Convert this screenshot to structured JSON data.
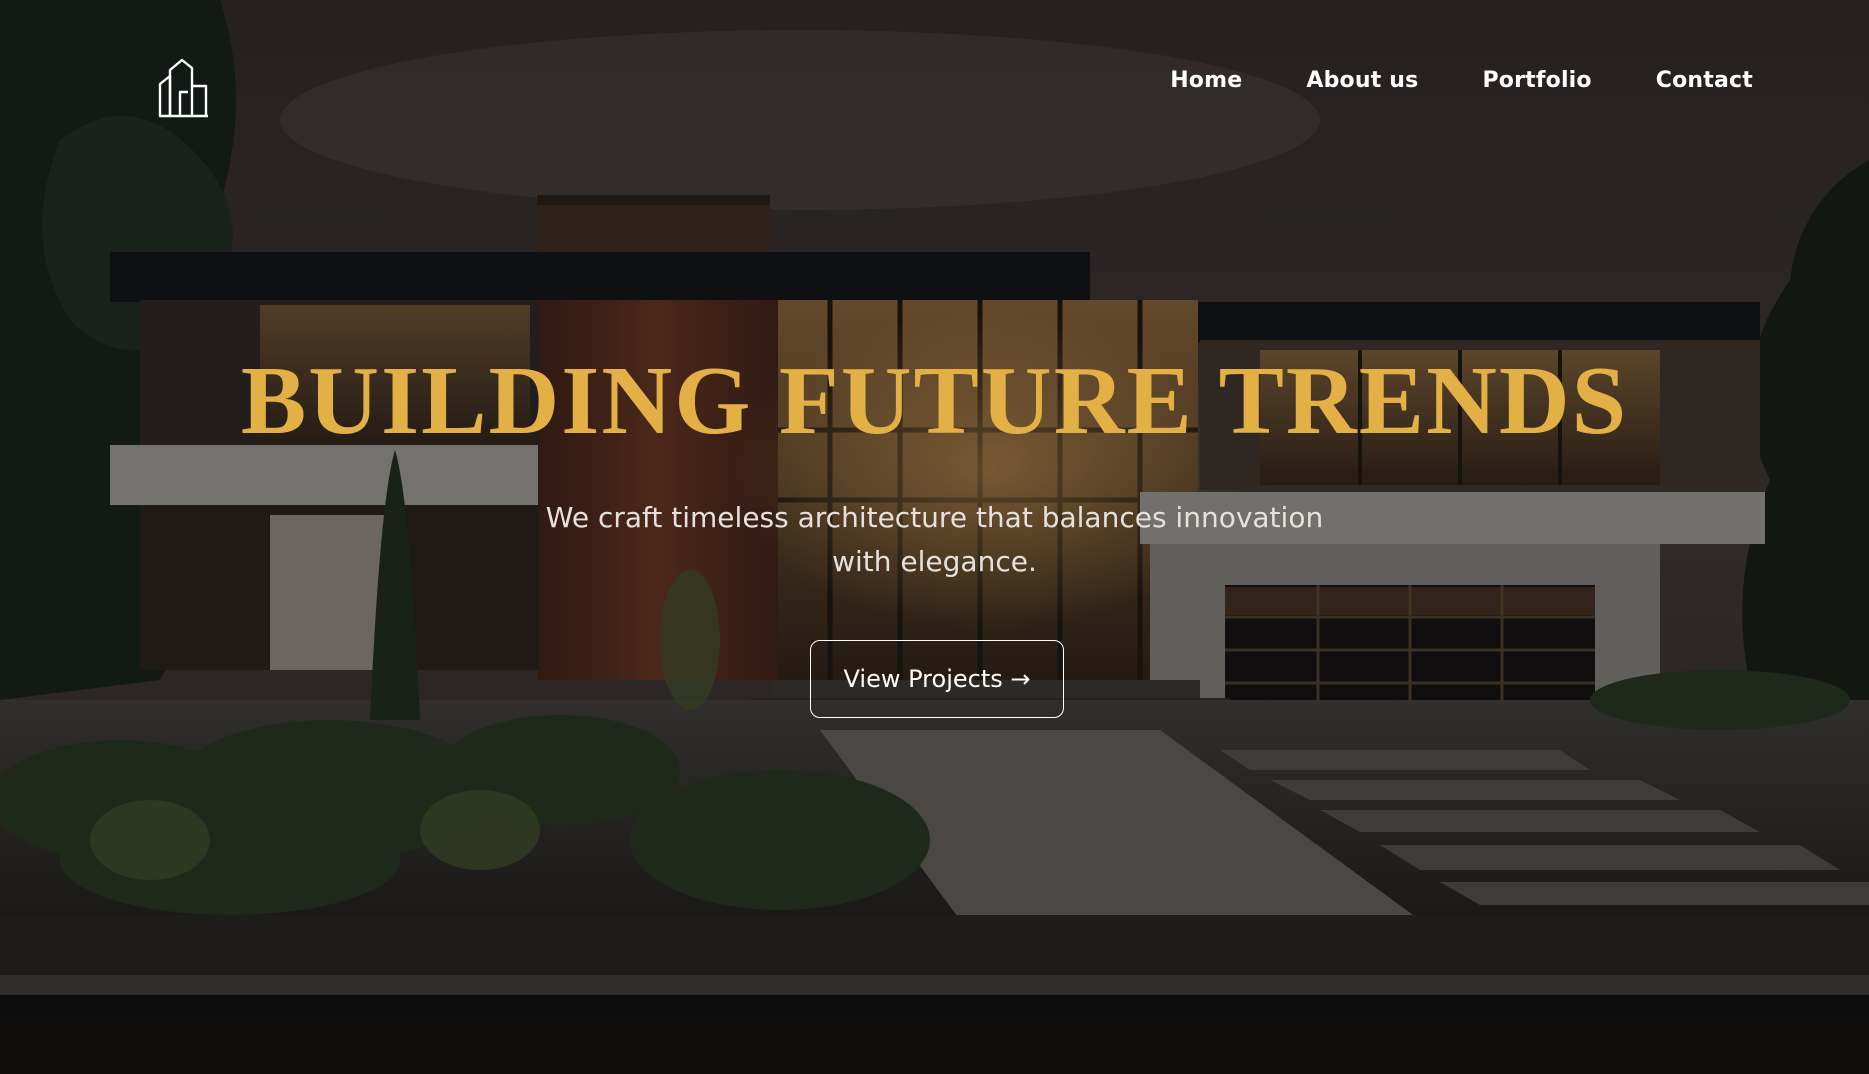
{
  "brand": {
    "logo_icon": "buildings-outline-icon"
  },
  "nav": {
    "items": [
      {
        "label": "Home"
      },
      {
        "label": "About us"
      },
      {
        "label": "Portfolio"
      },
      {
        "label": "Contact"
      }
    ]
  },
  "hero": {
    "headline": "BUILDING FUTURE TRENDS",
    "subheadline": "We craft timeless architecture that balances innovation with elegance.",
    "cta_label": "View Projects →",
    "background_image": "modern-house-at-dusk"
  },
  "colors": {
    "accent": "#e3b046",
    "text": "#ffffff",
    "subtext": "#e6e1dc"
  }
}
